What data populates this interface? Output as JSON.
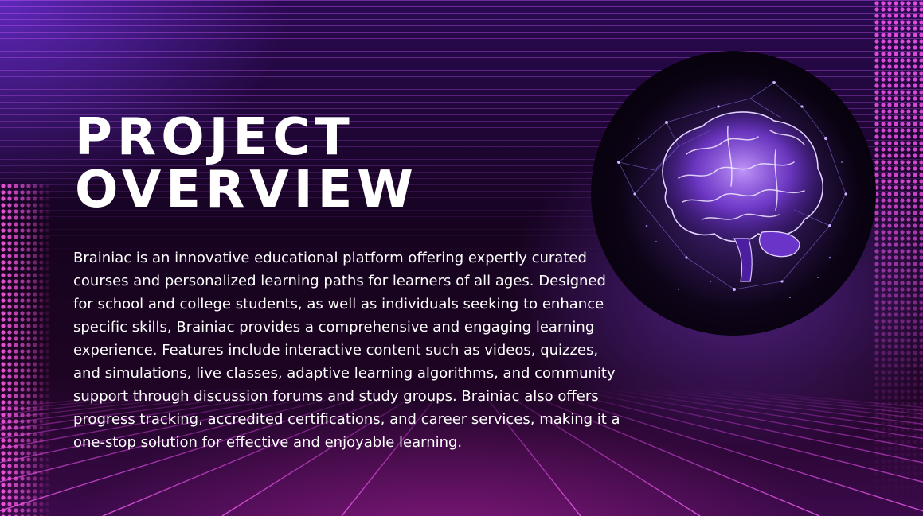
{
  "slide": {
    "title_line1": "PROJECT",
    "title_line2": "OVERVIEW",
    "body": "Brainiac is an innovative educational platform offering expertly curated courses and personalized learning paths for learners of all ages. Designed for school and college students, as well as individuals seeking to enhance specific skills, Brainiac provides a comprehensive and engaging learning experience. Features include interactive content such as videos, quizzes, and simulations, live classes, adaptive learning algorithms, and community support through discussion forums and study groups. Brainiac also offers progress tracking, accredited certifications, and career services, making it a one-stop solution for effective and enjoyable learning.",
    "image": "glowing-brain-illustration"
  },
  "colors": {
    "background_top": "#2a0a52",
    "background_dark": "#16031f",
    "accent_magenta": "#e04cdc",
    "accent_violet": "#a070ff",
    "text": "#ffffff"
  }
}
